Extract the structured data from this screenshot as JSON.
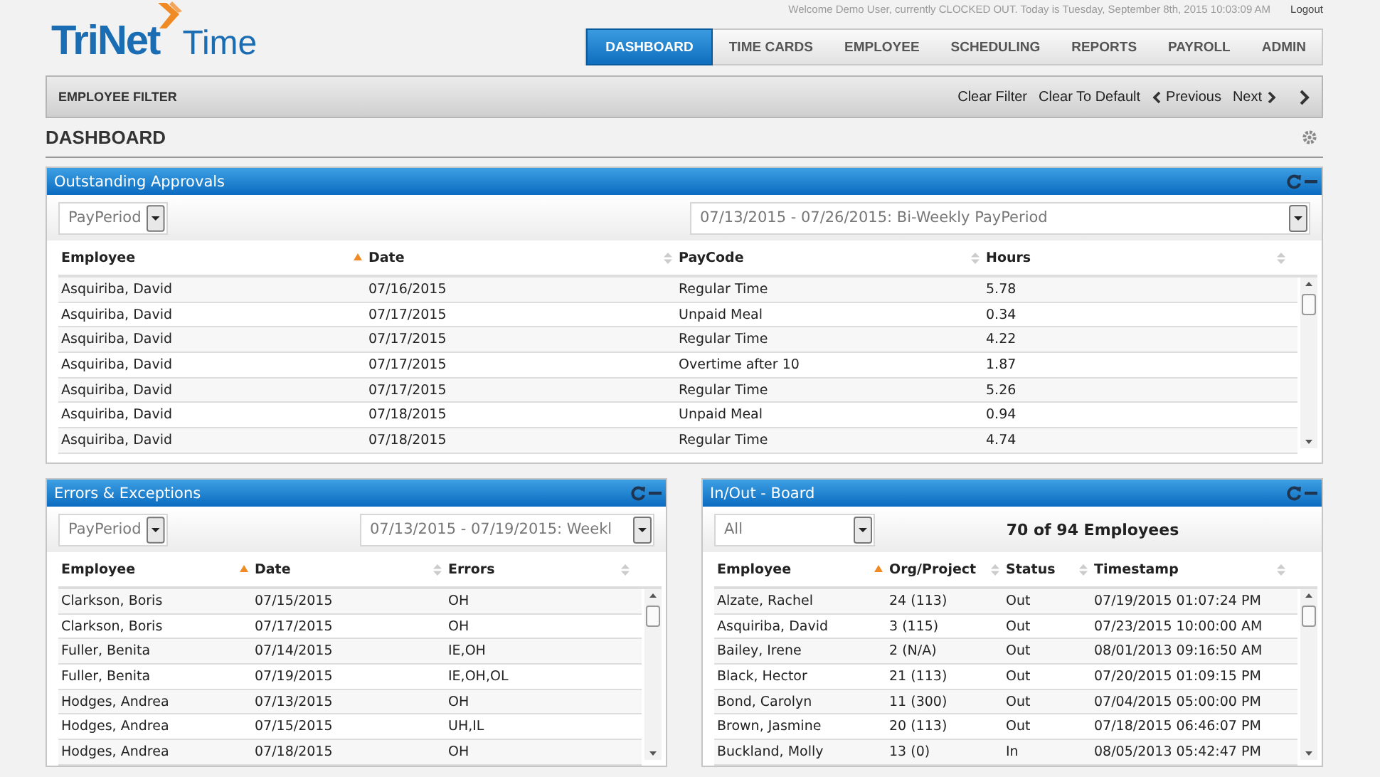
{
  "header": {
    "welcome": "Welcome Demo User, currently CLOCKED OUT. Today is Tuesday, September 8th, 2015 10:03:09 AM",
    "logout": "Logout",
    "logo": {
      "brand": "TriNet",
      "product": "Time"
    }
  },
  "nav": [
    {
      "label": "DASHBOARD",
      "selected": true
    },
    {
      "label": "TIME CARDS",
      "selected": false
    },
    {
      "label": "EMPLOYEE",
      "selected": false
    },
    {
      "label": "SCHEDULING",
      "selected": false
    },
    {
      "label": "REPORTS",
      "selected": false
    },
    {
      "label": "PAYROLL",
      "selected": false
    },
    {
      "label": "ADMIN",
      "selected": false
    }
  ],
  "filter_bar": {
    "title": "EMPLOYEE FILTER",
    "actions": [
      "Clear Filter",
      "Clear To Default"
    ],
    "previous": "Previous",
    "next": "Next"
  },
  "page_title": "DASHBOARD",
  "panels": [
    {
      "title": "Outstanding Approvals",
      "filter": "PayPeriod",
      "period": "07/13/2015 - 07/26/2015: Bi-Weekly PayPeriod",
      "columns": [
        {
          "label": "Employee",
          "sorted": true
        },
        {
          "label": "Date",
          "sorted": false
        },
        {
          "label": "PayCode",
          "sorted": false
        },
        {
          "label": "Hours",
          "sorted": false
        }
      ],
      "rows": [
        [
          "Asquiriba, David",
          "07/16/2015",
          "Regular Time",
          "5.78"
        ],
        [
          "Asquiriba, David",
          "07/17/2015",
          "Unpaid Meal",
          "0.34"
        ],
        [
          "Asquiriba, David",
          "07/17/2015",
          "Regular Time",
          "4.22"
        ],
        [
          "Asquiriba, David",
          "07/17/2015",
          "Overtime after 10",
          "1.87"
        ],
        [
          "Asquiriba, David",
          "07/17/2015",
          "Regular Time",
          "5.26"
        ],
        [
          "Asquiriba, David",
          "07/18/2015",
          "Unpaid Meal",
          "0.94"
        ],
        [
          "Asquiriba, David",
          "07/18/2015",
          "Regular Time",
          "4.74"
        ]
      ]
    },
    {
      "title": "Errors & Exceptions",
      "filter": "PayPeriod",
      "period": "07/13/2015 - 07/19/2015: Weekl",
      "columns": [
        {
          "label": "Employee",
          "sorted": true
        },
        {
          "label": "Date",
          "sorted": false
        },
        {
          "label": "Errors",
          "sorted": false
        }
      ],
      "rows": [
        [
          "Clarkson, Boris",
          "07/15/2015",
          "OH"
        ],
        [
          "Clarkson, Boris",
          "07/17/2015",
          "OH"
        ],
        [
          "Fuller, Benita",
          "07/14/2015",
          "IE,OH"
        ],
        [
          "Fuller, Benita",
          "07/19/2015",
          "IE,OH,OL"
        ],
        [
          "Hodges, Andrea",
          "07/13/2015",
          "OH"
        ],
        [
          "Hodges, Andrea",
          "07/15/2015",
          "UH,IL"
        ],
        [
          "Hodges, Andrea",
          "07/18/2015",
          "OH"
        ]
      ]
    },
    {
      "title": "In/Out - Board",
      "filter": "All",
      "count": "70 of 94 Employees",
      "columns": [
        {
          "label": "Employee",
          "sorted": true
        },
        {
          "label": "Org/Project",
          "sorted": false
        },
        {
          "label": "Status",
          "sorted": false
        },
        {
          "label": "Timestamp",
          "sorted": false
        }
      ],
      "rows": [
        [
          "Alzate, Rachel",
          "24 (113)",
          "Out",
          "07/19/2015 01:07:24 PM"
        ],
        [
          "Asquiriba, David",
          "3 (115)",
          "Out",
          "07/23/2015 10:00:00 AM"
        ],
        [
          "Bailey, Irene",
          "2 (N/A)",
          "Out",
          "08/01/2013 09:16:50 AM"
        ],
        [
          "Black, Hector",
          "21 (113)",
          "Out",
          "07/20/2015 01:09:15 PM"
        ],
        [
          "Bond, Carolyn",
          "11 (300)",
          "Out",
          "07/04/2015 05:00:00 PM"
        ],
        [
          "Brown, Jasmine",
          "20 (113)",
          "Out",
          "07/18/2015 06:46:07 PM"
        ],
        [
          "Buckland, Molly",
          "13 (0)",
          "In",
          "08/05/2013 05:42:47 PM"
        ]
      ]
    }
  ]
}
